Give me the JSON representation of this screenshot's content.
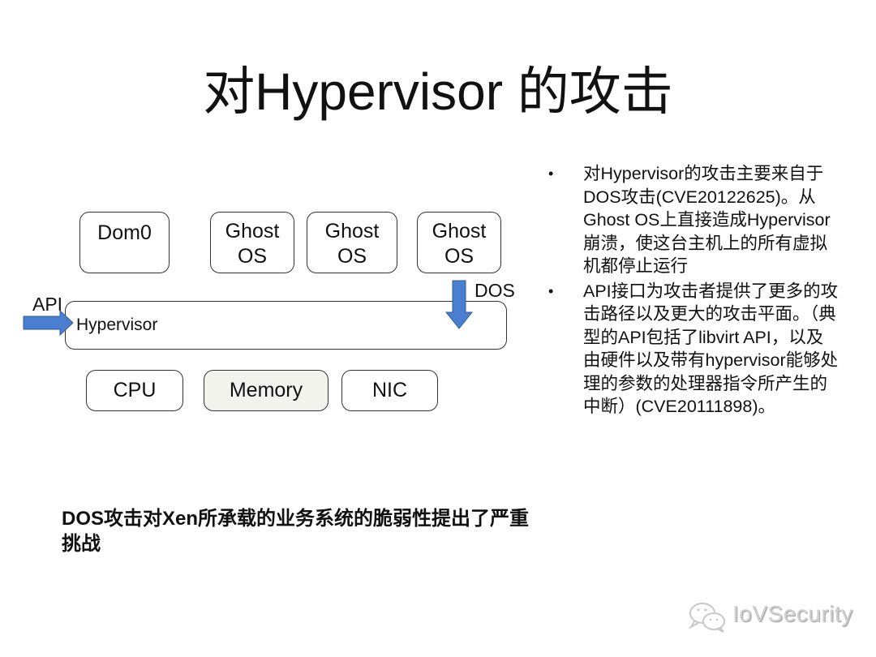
{
  "title": "对Hypervisor 的攻击",
  "diagram": {
    "top_boxes": [
      {
        "line1": "Dom0",
        "line2": ""
      },
      {
        "line1": "Ghost",
        "line2": "OS"
      },
      {
        "line1": "Ghost",
        "line2": "OS"
      },
      {
        "line1": "Ghost",
        "line2": "OS"
      }
    ],
    "hypervisor_label": "Hypervisor",
    "api_label": "API",
    "dos_label": "DOS",
    "arrow_color": "#4a7fcf",
    "bottom_boxes": [
      {
        "label": "CPU"
      },
      {
        "label": "Memory"
      },
      {
        "label": "NIC"
      }
    ]
  },
  "bullets": [
    {
      "symbol": "•",
      "text": "对Hypervisor的攻击主要来自于DOS攻击(CVE20122625)。从Ghost OS上直接造成Hypervisor崩溃，使这台主机上的所有虚拟机都停止运行"
    },
    {
      "symbol": "•",
      "text": "API接口为攻击者提供了更多的攻击路径以及更大的攻击平面。（典型的API包括了libvirt API，以及由硬件以及带有hypervisor能够处理的参数的处理器指令所产生的中断）(CVE20111898)。"
    }
  ],
  "bottom_text": "DOS攻击对Xen所承载的业务系统的脆弱性提出了严重挑战",
  "watermark": {
    "icon": "wechat-icon",
    "text": "IoVSecurity"
  }
}
